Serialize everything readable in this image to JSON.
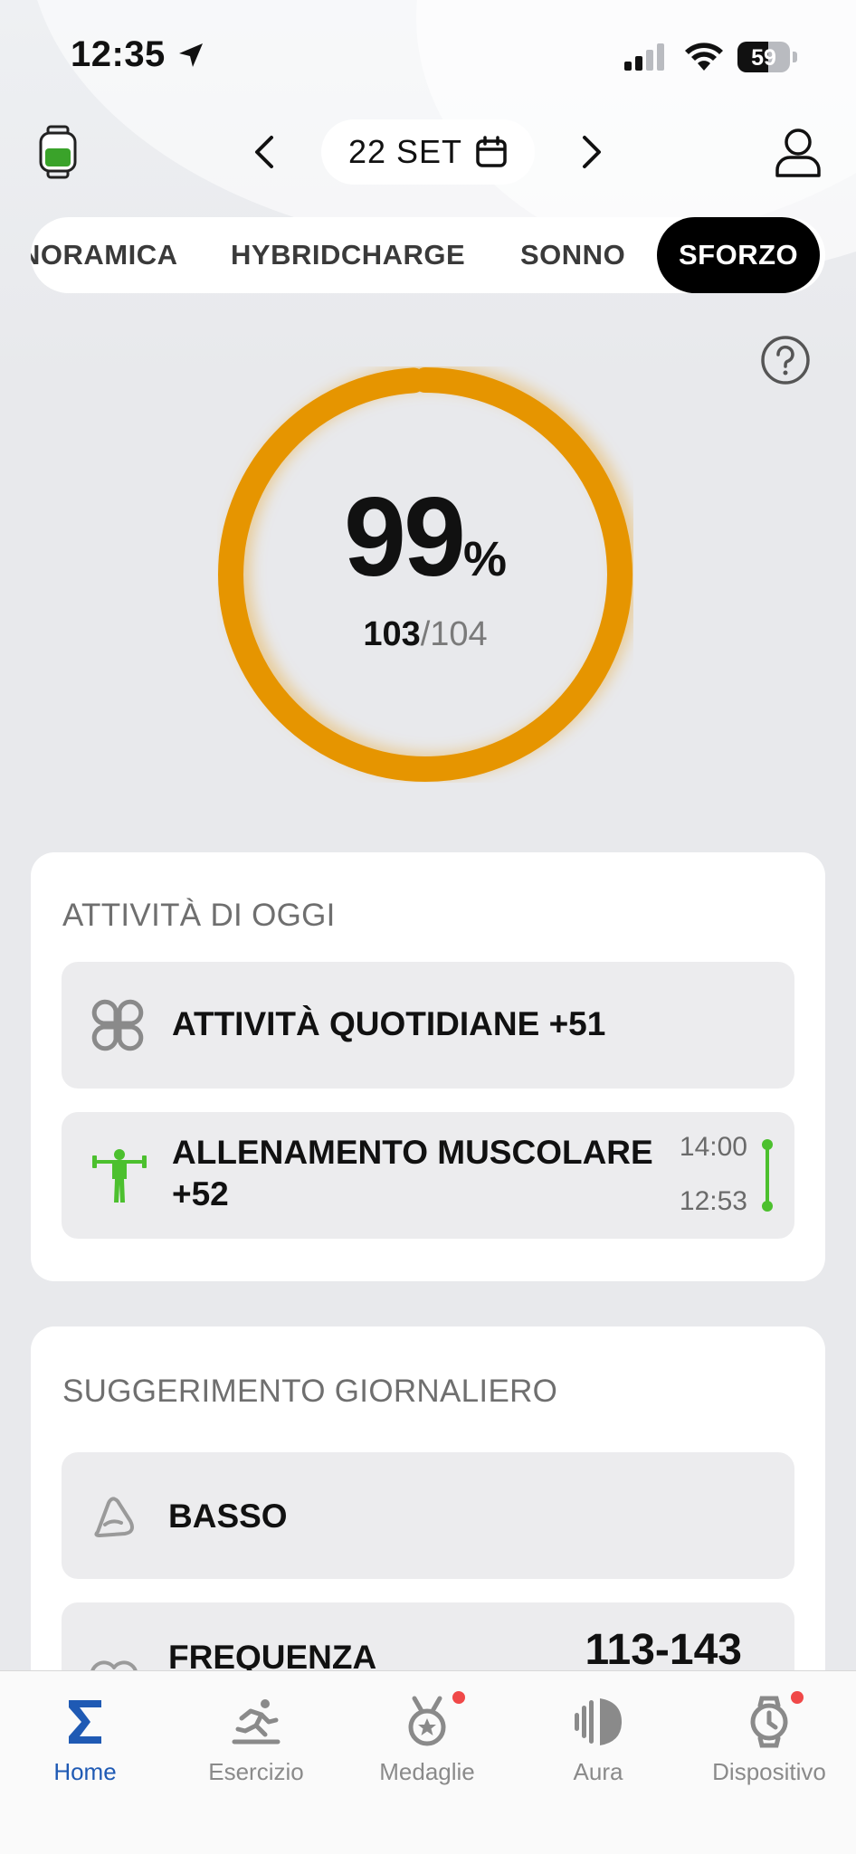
{
  "status_bar": {
    "time": "12:35",
    "battery": "59",
    "battery_level": 0.59
  },
  "header": {
    "date": "22 SET"
  },
  "tabs": [
    {
      "label": "NORAMICA",
      "active": false
    },
    {
      "label": "HYBRIDCHARGE",
      "active": false
    },
    {
      "label": "SONNO",
      "active": false
    },
    {
      "label": "SFORZO",
      "active": true
    }
  ],
  "strain": {
    "percent": "99",
    "percent_sign": "%",
    "current": "103",
    "separator": "/",
    "target": "104",
    "progress": 0.99,
    "ring_color": "#e69500"
  },
  "activities": {
    "title": "ATTIVITÀ DI OGGI",
    "items": [
      {
        "label": "ATTIVITÀ QUOTIDIANE +51",
        "icon": "four-petal-icon"
      },
      {
        "label_line1": "ALLENAMENTO MUSCOLARE",
        "label_line2": "+52",
        "icon": "weightlifter-icon",
        "end_time": "14:00",
        "start_time": "12:53",
        "accent": "#4cc02e"
      }
    ]
  },
  "suggestion": {
    "title": "SUGGERIMENTO GIORNALIERO",
    "level_label": "BASSO",
    "heart_rate_label": "FREQUENZA",
    "heart_rate_value": "113-143"
  },
  "bottom_nav": [
    {
      "label": "Home",
      "icon": "sigma-icon",
      "active": true
    },
    {
      "label": "Esercizio",
      "icon": "runner-icon",
      "active": false
    },
    {
      "label": "Medaglie",
      "icon": "medal-icon",
      "active": false,
      "badge": true
    },
    {
      "label": "Aura",
      "icon": "aura-icon",
      "active": false
    },
    {
      "label": "Dispositivo",
      "icon": "watch-icon",
      "active": false,
      "badge": true
    }
  ]
}
